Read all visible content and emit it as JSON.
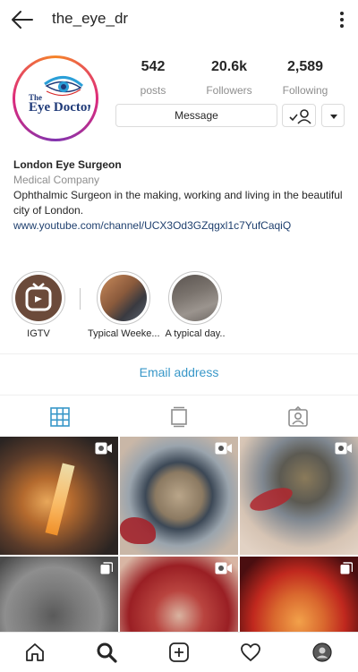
{
  "header": {
    "username": "the_eye_dr"
  },
  "avatar": {
    "logo_small": "The",
    "logo_main": "Eye Doctor"
  },
  "stats": [
    {
      "value": "542",
      "label": "posts"
    },
    {
      "value": "20.6k",
      "label": "Followers"
    },
    {
      "value": "2,589",
      "label": "Following"
    }
  ],
  "buttons": {
    "message": "Message"
  },
  "bio": {
    "name": "London Eye Surgeon",
    "category": "Medical Company",
    "text": "Ophthalmic Surgeon in the making, working and living in the beautiful city of London.",
    "link": "www.youtube.com/channel/UCX3Od3GZqgxl1c7YufCaqiQ"
  },
  "highlights": [
    {
      "label": "IGTV",
      "icon": "igtv-icon"
    },
    {
      "label": "Typical Weeke...",
      "icon": "cover-image"
    },
    {
      "label": "A typical day..",
      "icon": "cover-image"
    }
  ],
  "contact": {
    "email_label": "Email address"
  },
  "tabs": [
    {
      "name": "grid-tab",
      "icon": "grid-icon",
      "active": true
    },
    {
      "name": "igtv-tab",
      "icon": "igtv-tab-icon",
      "active": false
    },
    {
      "name": "tagged-tab",
      "icon": "tagged-icon",
      "active": false
    }
  ],
  "posts": [
    {
      "type": "video"
    },
    {
      "type": "video"
    },
    {
      "type": "video"
    },
    {
      "type": "carousel"
    },
    {
      "type": "video"
    },
    {
      "type": "carousel"
    }
  ],
  "bottom_nav": [
    {
      "icon": "home-icon"
    },
    {
      "icon": "search-icon",
      "active": true
    },
    {
      "icon": "new-post-icon"
    },
    {
      "icon": "activity-heart-icon"
    },
    {
      "icon": "profile-avatar-icon"
    }
  ],
  "colors": {
    "link": "#1e3f6e",
    "email": "#3897c8",
    "active_tab": "#3897c8",
    "muted": "#8e8e8e",
    "ring_start": "#f58529",
    "ring_end": "#8134af"
  }
}
